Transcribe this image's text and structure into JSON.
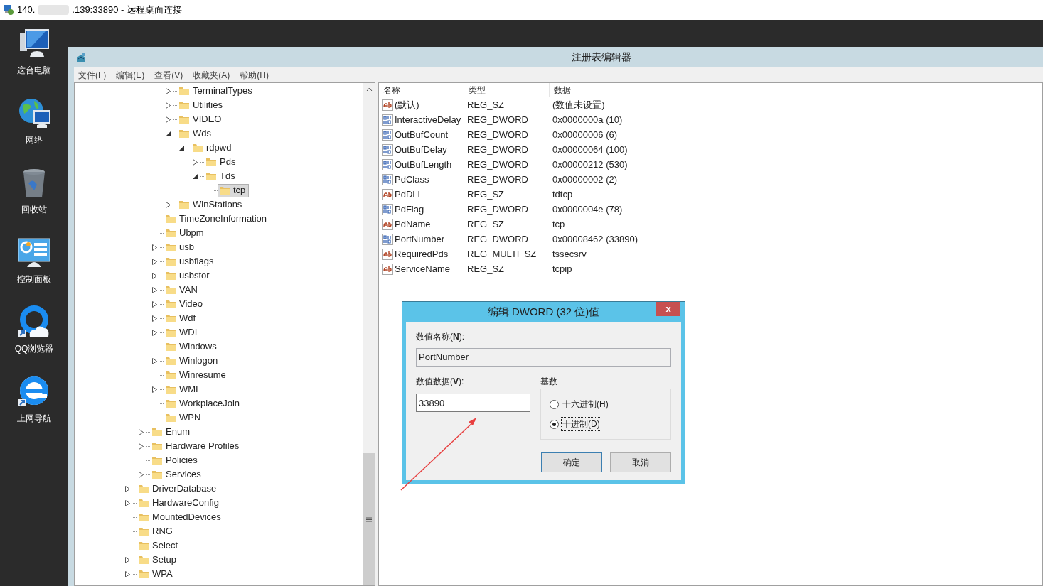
{
  "rdp_bar": {
    "title_start": "140.",
    "title_end": ".139:33890 - 远程桌面连接"
  },
  "desktop_icons": [
    {
      "label": "这台电脑",
      "kind": "computer"
    },
    {
      "label": "网络",
      "kind": "network"
    },
    {
      "label": "回收站",
      "kind": "recycle"
    },
    {
      "label": "控制面板",
      "kind": "control"
    },
    {
      "label": "QQ浏览器",
      "kind": "qq"
    },
    {
      "label": "上网导航",
      "kind": "ie"
    }
  ],
  "window": {
    "title": "注册表编辑器"
  },
  "menu": [
    "文件(F)",
    "编辑(E)",
    "查看(V)",
    "收藏夹(A)",
    "帮助(H)"
  ],
  "tree": [
    {
      "children": [
        {
          "children": [
            {
              "children": [
                {
                  "label": "TerminalTypes",
                  "expanded": false,
                  "selected": false
                },
                {
                  "label": "Utilities",
                  "expanded": false,
                  "selected": false
                },
                {
                  "label": "VIDEO",
                  "expanded": false,
                  "selected": false
                },
                {
                  "label": "Wds",
                  "expanded": true,
                  "selected": false,
                  "children": [
                    {
                      "label": "rdpwd",
                      "expanded": true,
                      "selected": false,
                      "children": [
                        {
                          "label": "Pds",
                          "expanded": false,
                          "selected": false
                        },
                        {
                          "label": "Tds",
                          "expanded": true,
                          "selected": false,
                          "children": [
                            {
                              "label": "tcp",
                              "selected": true
                            }
                          ]
                        }
                      ]
                    }
                  ]
                },
                {
                  "label": "WinStations",
                  "expanded": false,
                  "selected": false
                }
              ]
            },
            {
              "label": "TimeZoneInformation",
              "selected": false
            },
            {
              "label": "Ubpm",
              "selected": false
            },
            {
              "label": "usb",
              "expanded": false,
              "selected": false
            },
            {
              "label": "usbflags",
              "expanded": false,
              "selected": false
            },
            {
              "label": "usbstor",
              "expanded": false,
              "selected": false
            },
            {
              "label": "VAN",
              "expanded": false,
              "selected": false
            },
            {
              "label": "Video",
              "expanded": false,
              "selected": false
            },
            {
              "label": "Wdf",
              "expanded": false,
              "selected": false
            },
            {
              "label": "WDI",
              "expanded": false,
              "selected": false
            },
            {
              "label": "Windows",
              "selected": false
            },
            {
              "label": "Winlogon",
              "expanded": false,
              "selected": false
            },
            {
              "label": "Winresume",
              "selected": false
            },
            {
              "label": "WMI",
              "expanded": false,
              "selected": false
            },
            {
              "label": "WorkplaceJoin",
              "selected": false
            },
            {
              "label": "WPN",
              "selected": false
            }
          ]
        },
        {
          "label": "Enum",
          "expanded": false,
          "selected": false
        },
        {
          "label": "Hardware Profiles",
          "expanded": false,
          "selected": false
        },
        {
          "label": "Policies",
          "selected": false
        },
        {
          "label": "Services",
          "expanded": false,
          "selected": false
        }
      ]
    },
    {
      "label": "DriverDatabase",
      "expanded": false,
      "selected": false
    },
    {
      "label": "HardwareConfig",
      "expanded": false,
      "selected": false
    },
    {
      "label": "MountedDevices",
      "selected": false
    },
    {
      "label": "RNG",
      "selected": false
    },
    {
      "label": "Select",
      "selected": false
    },
    {
      "label": "Setup",
      "expanded": false,
      "selected": false
    },
    {
      "label": "WPA",
      "expanded": false,
      "selected": false
    }
  ],
  "values": {
    "columns": [
      "名称",
      "类型",
      "数据"
    ],
    "rows": [
      {
        "kind": "string",
        "name": "(默认)",
        "type": "REG_SZ",
        "data": "(数值未设置)"
      },
      {
        "kind": "binary",
        "name": "InteractiveDelay",
        "type": "REG_DWORD",
        "data": "0x0000000a (10)"
      },
      {
        "kind": "binary",
        "name": "OutBufCount",
        "type": "REG_DWORD",
        "data": "0x00000006 (6)"
      },
      {
        "kind": "binary",
        "name": "OutBufDelay",
        "type": "REG_DWORD",
        "data": "0x00000064 (100)"
      },
      {
        "kind": "binary",
        "name": "OutBufLength",
        "type": "REG_DWORD",
        "data": "0x00000212 (530)"
      },
      {
        "kind": "binary",
        "name": "PdClass",
        "type": "REG_DWORD",
        "data": "0x00000002 (2)"
      },
      {
        "kind": "string",
        "name": "PdDLL",
        "type": "REG_SZ",
        "data": "tdtcp"
      },
      {
        "kind": "binary",
        "name": "PdFlag",
        "type": "REG_DWORD",
        "data": "0x0000004e (78)"
      },
      {
        "kind": "string",
        "name": "PdName",
        "type": "REG_SZ",
        "data": "tcp"
      },
      {
        "kind": "binary",
        "name": "PortNumber",
        "type": "REG_DWORD",
        "data": "0x00008462 (33890)"
      },
      {
        "kind": "string",
        "name": "RequiredPds",
        "type": "REG_MULTI_SZ",
        "data": "tssecsrv"
      },
      {
        "kind": "string",
        "name": "ServiceName",
        "type": "REG_SZ",
        "data": "tcpip"
      }
    ]
  },
  "dialog": {
    "title": "编辑 DWORD (32 位)值",
    "close": "x",
    "name_label": "数值名称(**N**):",
    "name_value": "PortNumber",
    "data_label": "数值数据(**V**):",
    "data_value": "33890",
    "base_label": "基数",
    "bases": [
      {
        "label": "十六进制(H)",
        "selected": false
      },
      {
        "label": "十进制(D)",
        "selected": true
      }
    ],
    "buttons": [
      "确定",
      "取消"
    ]
  }
}
